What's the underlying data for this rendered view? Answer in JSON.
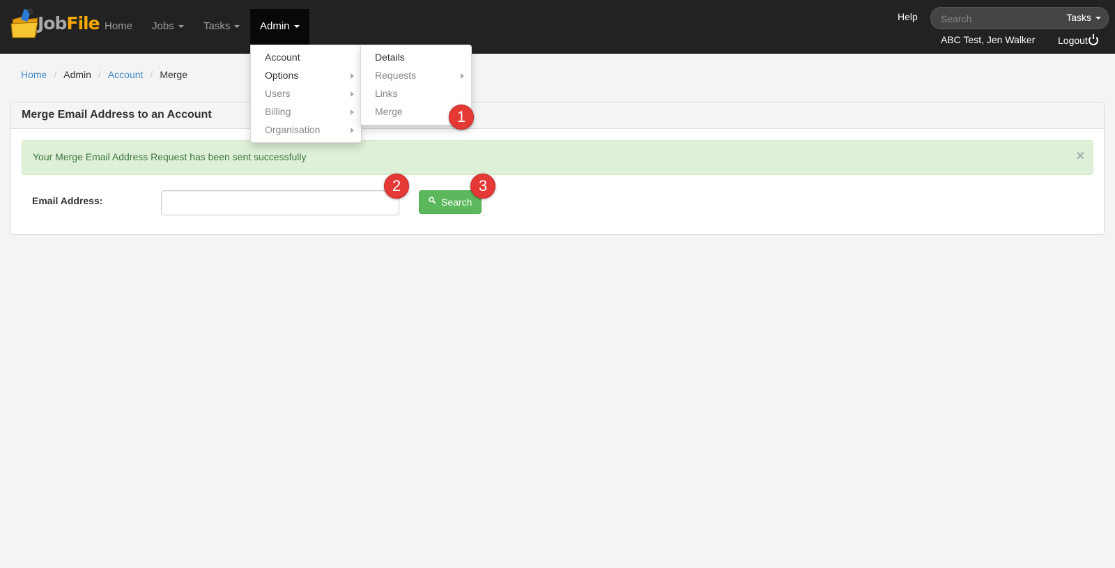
{
  "brand": {
    "logo_part1": "Job",
    "logo_part2": "File"
  },
  "nav": {
    "home": "Home",
    "jobs": "Jobs",
    "tasks": "Tasks",
    "admin": "Admin",
    "help": "Help",
    "search_placeholder": "Search",
    "search_scope": "Tasks",
    "user": "ABC Test, Jen Walker",
    "logout": "Logout"
  },
  "admin_menu": {
    "items": [
      {
        "label": "Account",
        "submenu": false
      },
      {
        "label": "Options",
        "submenu": true
      },
      {
        "label": "Users",
        "submenu": true
      },
      {
        "label": "Billing",
        "submenu": true
      },
      {
        "label": "Organisation",
        "submenu": true
      }
    ]
  },
  "account_submenu": {
    "items": [
      {
        "label": "Details",
        "submenu": false
      },
      {
        "label": "Requests",
        "submenu": true
      },
      {
        "label": "Links",
        "submenu": false
      },
      {
        "label": "Merge",
        "submenu": false
      }
    ]
  },
  "breadcrumb": [
    "Home",
    "Admin",
    "Account",
    "Merge"
  ],
  "panel": {
    "title": "Merge Email Address to an Account",
    "alert": "Your Merge Email Address Request has been sent successfully",
    "alert_close": "×",
    "email_label": "Email Address:",
    "email_value": "",
    "search_button": "Search"
  },
  "annotations": [
    "1",
    "2",
    "3"
  ],
  "colors": {
    "navbar": "#222222",
    "success": "#5cb85c",
    "link": "#428bca",
    "badge": "#e53935"
  }
}
